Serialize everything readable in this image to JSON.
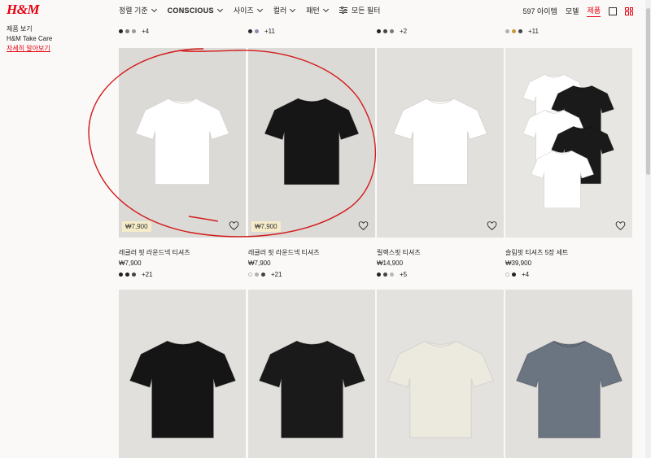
{
  "brand": "H&M",
  "filters": [
    {
      "label": "정렬 기준"
    },
    {
      "label": "CONSCIOUS"
    },
    {
      "label": "사이즈"
    },
    {
      "label": "컬러"
    },
    {
      "label": "패턴"
    }
  ],
  "all_filters_label": "모든 필터",
  "item_count": "597 아이템",
  "view_model": "모델",
  "view_product": "제품",
  "sidebar": {
    "line1": "제품 보기",
    "line2": "H&M Take Care",
    "link": "자세히 알아보기"
  },
  "top_swatch_rows": [
    {
      "colors": [
        "#222222",
        "#7a7a7a",
        "#9a9a9a"
      ],
      "more": "+4"
    },
    {
      "colors": [
        "#2a2a2a",
        "#8c8fb0"
      ],
      "more": "+11"
    },
    {
      "colors": [
        "#222222",
        "#444444",
        "#7a7a7a"
      ],
      "more": "+2"
    },
    {
      "colors": [
        "#b0b0b0",
        "#c69a3a",
        "#444444"
      ],
      "more": "+11"
    }
  ],
  "products": [
    {
      "name": "레귤러 핏 라운드넥 티셔츠",
      "price": "₩7,900",
      "tag": "₩7,900",
      "tee_color": "#ffffff",
      "bg": "#dcdad6",
      "swatches": [
        "#222222",
        "#222222",
        "#444444"
      ],
      "more": "+21"
    },
    {
      "name": "레귤러 핏 라운드넥 티셔츠",
      "price": "₩7,900",
      "tag": "₩7,900",
      "tee_color": "#161616",
      "bg": "#dcdad6",
      "swatches": [
        "#ffffff",
        "#b0b0b0",
        "#444444"
      ],
      "more": "+21"
    },
    {
      "name": "릴랙스핏 티셔츠",
      "price": "₩14,900",
      "tee_color": "#ffffff",
      "bg": "#e2e0dc",
      "swatches": [
        "#222222",
        "#444444",
        "#b8b8b8"
      ],
      "more": "+5"
    },
    {
      "name": "슬림핏 티셔츠 5장 세트",
      "price": "₩39,900",
      "tee_color": "#ffffff",
      "bg": "#e8e6e2",
      "swatches": [
        "#ffffff",
        "#222222"
      ],
      "more": "+4"
    },
    {
      "tee_color": "#151515",
      "bg": "#e2e0dc"
    },
    {
      "tee_color": "#1a1a1a",
      "bg": "#e2e0dc"
    },
    {
      "tee_color": "#ece9df",
      "bg": "#e4e2de"
    },
    {
      "tee_color": "#6b7582",
      "bg": "#e2e0dc"
    }
  ]
}
